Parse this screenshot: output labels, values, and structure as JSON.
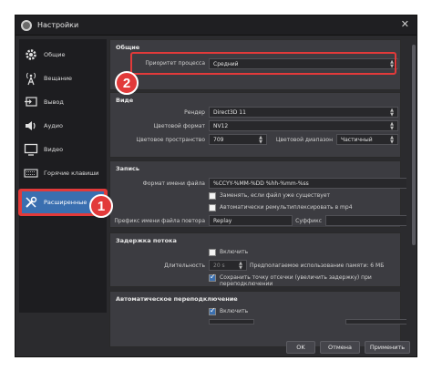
{
  "window": {
    "title": "Настройки"
  },
  "sidebar": {
    "items": [
      {
        "label": "Общие",
        "icon": "gear-icon"
      },
      {
        "label": "Вещание",
        "icon": "broadcast-icon"
      },
      {
        "label": "Вывод",
        "icon": "output-icon"
      },
      {
        "label": "Аудио",
        "icon": "speaker-icon"
      },
      {
        "label": "Видео",
        "icon": "monitor-icon"
      },
      {
        "label": "Горячие клавиши",
        "icon": "keyboard-icon"
      },
      {
        "label": "Расширенные",
        "icon": "tools-icon",
        "active": true
      }
    ]
  },
  "general": {
    "title": "Общие",
    "priority_label": "Приоритет процесса",
    "priority_value": "Средний"
  },
  "video": {
    "title": "Виде",
    "renderer_label": "Рендер",
    "renderer_value": "Direct3D 11",
    "color_format_label": "Цветовой формат",
    "color_format_value": "NV12",
    "color_space_label": "Цветовое пространство",
    "color_space_value": "709",
    "color_range_label": "Цветовой диапазон",
    "color_range_value": "Частичный"
  },
  "recording": {
    "title": "Запись",
    "filename_format_label": "Формат имени файла",
    "filename_format_value": "%CCYY-%MM-%DD %hh-%mm-%ss",
    "overwrite_label": "Заменять, если файл уже существует",
    "overwrite_checked": false,
    "remux_label": "Автоматически ремультиплексировать в mp4",
    "remux_checked": false,
    "replay_prefix_label": "Префикс имени файла повтора",
    "replay_prefix_value": "Replay",
    "suffix_label": "Суффикс",
    "suffix_value": ""
  },
  "stream_delay": {
    "title": "Задержка потока",
    "enable_label": "Включить",
    "enable_checked": false,
    "duration_label": "Длительность",
    "duration_value": "20 s",
    "memory_note": "Предполагаемое использование памяти: 6 МБ",
    "preserve_label": "Сохранить точку отсечки (увеличить задержку) при переподключении",
    "preserve_checked": true
  },
  "reconnect": {
    "title": "Автоматическое переподключение",
    "enable_label": "Включить",
    "enable_checked": true
  },
  "badges": {
    "one": "1",
    "two": "2"
  },
  "footer": {
    "ok": "OK",
    "cancel": "Отмена",
    "apply": "Применить"
  },
  "colors": {
    "accent": "#3a6fb0",
    "highlight": "#e23a3a"
  }
}
